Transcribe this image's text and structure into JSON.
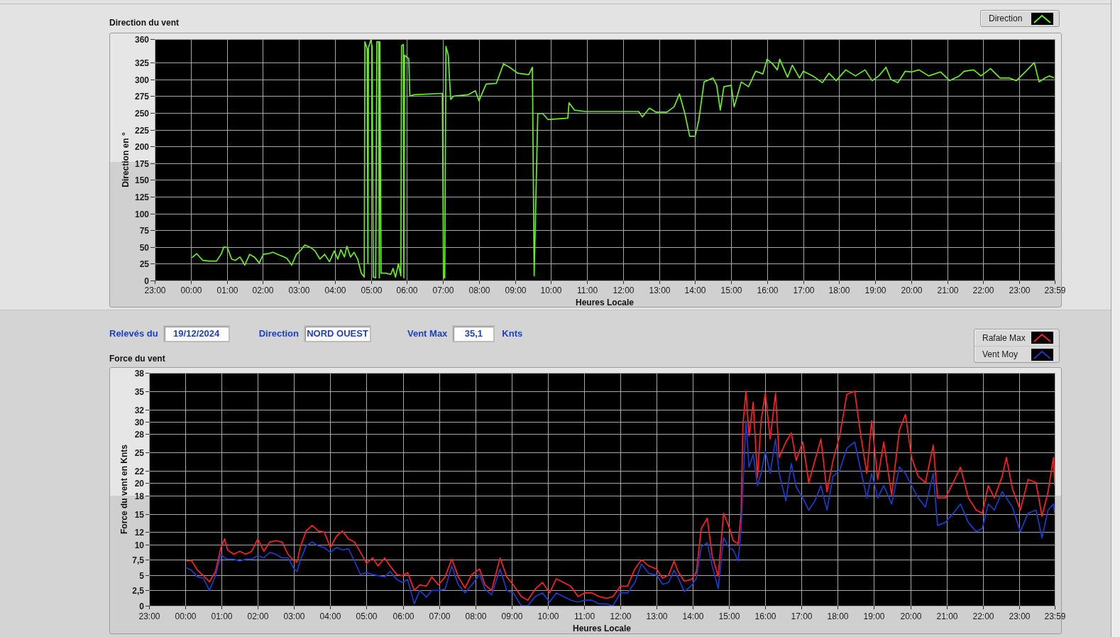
{
  "direction_graph": {
    "chart_data": {
      "type": "line",
      "title": "Direction du vent",
      "xlabel": "Heures Locale",
      "ylabel": "Direction en °",
      "grid": true,
      "x": [
        "2024-12-19 00:02",
        "2024-12-19 00:10",
        "2024-12-19 00:20",
        "2024-12-19 00:31",
        "2024-12-19 00:43",
        "2024-12-19 00:51",
        "2024-12-19 00:55",
        "2024-12-19 01:01",
        "2024-12-19 01:08",
        "2024-12-19 01:14",
        "2024-12-19 01:22",
        "2024-12-19 01:30",
        "2024-12-19 01:38",
        "2024-12-19 01:46",
        "2024-12-19 01:54",
        "2024-12-19 02:01",
        "2024-12-19 02:09",
        "2024-12-19 02:17",
        "2024-12-19 02:25",
        "2024-12-19 02:33",
        "2024-12-19 02:40",
        "2024-12-19 02:48",
        "2024-12-19 02:56",
        "2024-12-19 03:04",
        "2024-12-19 03:10",
        "2024-12-19 03:20",
        "2024-12-19 03:27",
        "2024-12-19 03:35",
        "2024-12-19 03:43",
        "2024-12-19 03:51",
        "2024-12-19 03:59",
        "2024-12-19 04:05",
        "2024-12-19 04:10",
        "2024-12-19 04:16",
        "2024-12-19 04:20",
        "2024-12-19 04:26",
        "2024-12-19 04:32",
        "2024-12-19 04:38",
        "2024-12-19 04:44",
        "2024-12-19 04:49",
        "2024-12-19 04:50",
        "2024-12-19 04:54",
        "2024-12-19 04:55",
        "2024-12-19 04:56",
        "2024-12-19 05:00",
        "2024-12-19 05:02",
        "2024-12-19 05:04",
        "2024-12-19 05:08",
        "2024-12-19 05:10",
        "2024-12-19 05:13",
        "2024-12-19 05:14",
        "2024-12-19 05:15",
        "2024-12-19 05:17",
        "2024-12-19 05:25",
        "2024-12-19 05:33",
        "2024-12-19 05:37",
        "2024-12-19 05:41",
        "2024-12-19 05:46",
        "2024-12-19 05:50",
        "2024-12-19 05:51",
        "2024-12-19 05:54",
        "2024-12-19 05:55",
        "2024-12-19 05:56",
        "2024-12-19 06:00",
        "2024-12-19 06:03",
        "2024-12-19 06:05",
        "2024-12-19 06:12",
        "2024-12-19 06:59",
        "2024-12-19 07:01",
        "2024-12-19 07:03",
        "2024-12-19 07:05",
        "2024-12-19 07:09",
        "2024-12-19 07:11",
        "2024-12-19 07:13",
        "2024-12-19 07:18",
        "2024-12-19 07:42",
        "2024-12-19 07:54",
        "2024-12-19 08:00",
        "2024-12-19 08:12",
        "2024-12-19 08:29",
        "2024-12-19 08:41",
        "2024-12-19 08:51",
        "2024-12-19 09:05",
        "2024-12-19 09:23",
        "2024-12-19 09:29",
        "2024-12-19 09:32",
        "2024-12-19 09:38",
        "2024-12-19 09:46",
        "2024-12-19 09:55",
        "2024-12-19 10:28",
        "2024-12-19 10:30",
        "2024-12-19 10:39",
        "2024-12-19 10:57",
        "2024-12-19 11:27",
        "2024-12-19 11:56",
        "2024-12-19 12:26",
        "2024-12-19 12:32",
        "2024-12-19 12:44",
        "2024-12-19 12:55",
        "2024-12-19 13:13",
        "2024-12-19 13:25",
        "2024-12-19 13:34",
        "2024-12-19 13:43",
        "2024-12-19 13:51",
        "2024-12-19 14:00",
        "2024-12-19 14:06",
        "2024-12-19 14:15",
        "2024-12-19 14:30",
        "2024-12-19 14:36",
        "2024-12-19 14:42",
        "2024-12-19 14:48",
        "2024-12-19 15:00",
        "2024-12-19 15:05",
        "2024-12-19 15:17",
        "2024-12-19 15:29",
        "2024-12-19 15:41",
        "2024-12-19 15:53",
        "2024-12-19 16:00",
        "2024-12-19 16:09",
        "2024-12-19 16:17",
        "2024-12-19 16:21",
        "2024-12-19 16:34",
        "2024-12-19 16:42",
        "2024-12-19 16:54",
        "2024-12-19 17:00",
        "2024-12-19 17:16",
        "2024-12-19 17:32",
        "2024-12-19 17:43",
        "2024-12-19 17:55",
        "2024-12-19 18:11",
        "2024-12-19 18:27",
        "2024-12-19 18:43",
        "2024-12-19 18:55",
        "2024-12-19 19:06",
        "2024-12-19 19:18",
        "2024-12-19 19:26",
        "2024-12-19 19:38",
        "2024-12-19 19:50",
        "2024-12-19 20:01",
        "2024-12-19 20:13",
        "2024-12-19 20:29",
        "2024-12-19 20:49",
        "2024-12-19 21:04",
        "2024-12-19 21:20",
        "2024-12-19 21:28",
        "2024-12-19 21:44",
        "2024-12-19 21:56",
        "2024-12-19 22:12",
        "2024-12-19 22:28",
        "2024-12-19 22:43",
        "2024-12-19 22:55",
        "2024-12-19 23:11",
        "2024-12-19 23:25",
        "2024-12-19 23:33",
        "2024-12-19 23:43",
        "2024-12-19 23:50",
        "2024-12-19 23:58"
      ],
      "series": [
        {
          "name": "Direction",
          "color": "#66f01e",
          "values": [
            34,
            40,
            30,
            29,
            29,
            40,
            50,
            49,
            32,
            30,
            35,
            23,
            39,
            35,
            26,
            39,
            40,
            42,
            39,
            36,
            33,
            23,
            39,
            46,
            53,
            49,
            44,
            32,
            39,
            28,
            44,
            32,
            46,
            35,
            51,
            35,
            42,
            32,
            11,
            5,
            356,
            345,
            26,
            347,
            359,
            349,
            5,
            4,
            356,
            356,
            4,
            356,
            11,
            11,
            9,
            18,
            5,
            25,
            7,
            350,
            352,
            4,
            336,
            333,
            331,
            275,
            277,
            279,
            4,
            4,
            349,
            336,
            301,
            270,
            275,
            277,
            283,
            268,
            293,
            294,
            323,
            318,
            309,
            307,
            318,
            7,
            249,
            249,
            240,
            242,
            265,
            254,
            252,
            252,
            252,
            252,
            244,
            257,
            251,
            251,
            259,
            278,
            249,
            215,
            215,
            238,
            296,
            302,
            291,
            254,
            289,
            291,
            259,
            296,
            289,
            312,
            308,
            330,
            323,
            314,
            330,
            303,
            321,
            302,
            312,
            305,
            295,
            309,
            298,
            314,
            305,
            314,
            298,
            305,
            318,
            300,
            295,
            312,
            311,
            314,
            305,
            311,
            298,
            305,
            312,
            314,
            305,
            316,
            302,
            302,
            298,
            312,
            325,
            296,
            302,
            305,
            302
          ]
        }
      ],
      "xlim": [
        "2024-12-18 23:00",
        "2024-12-19 23:59"
      ],
      "ylim": [
        0,
        360
      ],
      "xticks": [
        {
          "value": "2024-12-18 23:00",
          "label": "23:00"
        },
        {
          "value": "2024-12-19 00:00",
          "label": "00:00"
        },
        {
          "value": "2024-12-19 01:00",
          "label": "01:00"
        },
        {
          "value": "2024-12-19 02:00",
          "label": "02:00"
        },
        {
          "value": "2024-12-19 03:00",
          "label": "03:00"
        },
        {
          "value": "2024-12-19 04:00",
          "label": "04:00"
        },
        {
          "value": "2024-12-19 05:00",
          "label": "05:00"
        },
        {
          "value": "2024-12-19 06:00",
          "label": "06:00"
        },
        {
          "value": "2024-12-19 07:00",
          "label": "07:00"
        },
        {
          "value": "2024-12-19 08:00",
          "label": "08:00"
        },
        {
          "value": "2024-12-19 09:00",
          "label": "09:00"
        },
        {
          "value": "2024-12-19 10:00",
          "label": "10:00"
        },
        {
          "value": "2024-12-19 11:00",
          "label": "11:00"
        },
        {
          "value": "2024-12-19 12:00",
          "label": "12:00"
        },
        {
          "value": "2024-12-19 13:00",
          "label": "13:00"
        },
        {
          "value": "2024-12-19 14:00",
          "label": "14:00"
        },
        {
          "value": "2024-12-19 15:00",
          "label": "15:00"
        },
        {
          "value": "2024-12-19 16:00",
          "label": "16:00"
        },
        {
          "value": "2024-12-19 17:00",
          "label": "17:00"
        },
        {
          "value": "2024-12-19 18:00",
          "label": "18:00"
        },
        {
          "value": "2024-12-19 19:00",
          "label": "19:00"
        },
        {
          "value": "2024-12-19 20:00",
          "label": "20:00"
        },
        {
          "value": "2024-12-19 21:00",
          "label": "21:00"
        },
        {
          "value": "2024-12-19 22:00",
          "label": "22:00"
        },
        {
          "value": "2024-12-19 23:00",
          "label": "23:00"
        },
        {
          "value": "2024-12-19 23:59",
          "label": "23:59"
        }
      ],
      "yticks": [
        0,
        25,
        50,
        75,
        100,
        125,
        150,
        175,
        200,
        225,
        250,
        275,
        300,
        325,
        360
      ]
    }
  },
  "readings": [
    {
      "label": "Relevés du",
      "value": "19/12/2024"
    },
    {
      "label": "Direction",
      "value": "NORD OUEST"
    },
    {
      "label": "Vent Max",
      "value": "35,1",
      "unit": "Knts"
    }
  ],
  "force_graph": {
    "chart_data": {
      "type": "line",
      "title": "Force du vent",
      "xlabel": "Heures Locale",
      "ylabel": "Force du vent en Knts",
      "grid": true,
      "x": [
        "2024-12-19 00:02",
        "2024-12-19 00:10",
        "2024-12-19 00:20",
        "2024-12-19 00:30",
        "2024-12-19 00:40",
        "2024-12-19 00:50",
        "2024-12-19 00:59",
        "2024-12-19 01:05",
        "2024-12-19 01:10",
        "2024-12-19 01:20",
        "2024-12-19 01:30",
        "2024-12-19 01:40",
        "2024-12-19 01:50",
        "2024-12-19 02:00",
        "2024-12-19 02:10",
        "2024-12-19 02:20",
        "2024-12-19 02:30",
        "2024-12-19 02:40",
        "2024-12-19 02:50",
        "2024-12-19 03:00",
        "2024-12-19 03:05",
        "2024-12-19 03:10",
        "2024-12-19 03:20",
        "2024-12-19 03:30",
        "2024-12-19 03:40",
        "2024-12-19 03:50",
        "2024-12-19 04:00",
        "2024-12-19 04:10",
        "2024-12-19 04:20",
        "2024-12-19 04:30",
        "2024-12-19 04:40",
        "2024-12-19 04:50",
        "2024-12-19 05:00",
        "2024-12-19 05:10",
        "2024-12-19 05:19",
        "2024-12-19 05:30",
        "2024-12-19 05:39",
        "2024-12-19 05:50",
        "2024-12-19 05:59",
        "2024-12-19 06:08",
        "2024-12-19 06:19",
        "2024-12-19 06:28",
        "2024-12-19 06:39",
        "2024-12-19 06:48",
        "2024-12-19 06:59",
        "2024-12-19 07:10",
        "2024-12-19 07:21",
        "2024-12-19 07:32",
        "2024-12-19 07:43",
        "2024-12-19 07:54",
        "2024-12-19 08:07",
        "2024-12-19 08:16",
        "2024-12-19 08:27",
        "2024-12-19 08:41",
        "2024-12-19 08:52",
        "2024-12-19 09:03",
        "2024-12-19 09:16",
        "2024-12-19 09:27",
        "2024-12-19 09:39",
        "2024-12-19 09:51",
        "2024-12-19 10:03",
        "2024-12-19 10:14",
        "2024-12-19 10:26",
        "2024-12-19 10:38",
        "2024-12-19 10:50",
        "2024-12-19 11:01",
        "2024-12-19 11:13",
        "2024-12-19 11:25",
        "2024-12-19 11:37",
        "2024-12-19 11:48",
        "2024-12-19 12:00",
        "2024-12-19 12:12",
        "2024-12-19 12:24",
        "2024-12-19 12:35",
        "2024-12-19 12:47",
        "2024-12-19 13:00",
        "2024-12-19 13:10",
        "2024-12-19 13:20",
        "2024-12-19 13:29",
        "2024-12-19 13:36",
        "2024-12-19 13:46",
        "2024-12-19 13:58",
        "2024-12-19 14:06",
        "2024-12-19 14:14",
        "2024-12-19 14:24",
        "2024-12-19 14:32",
        "2024-12-19 14:42",
        "2024-12-19 14:51",
        "2024-12-19 14:59",
        "2024-12-19 15:07",
        "2024-12-19 15:15",
        "2024-12-19 15:20",
        "2024-12-19 15:23",
        "2024-12-19 15:28",
        "2024-12-19 15:33",
        "2024-12-19 15:40",
        "2024-12-19 15:47",
        "2024-12-19 15:53",
        "2024-12-19 16:00",
        "2024-12-19 16:08",
        "2024-12-19 16:17",
        "2024-12-19 16:23",
        "2024-12-19 16:34",
        "2024-12-19 16:43",
        "2024-12-19 16:51",
        "2024-12-19 17:02",
        "2024-12-19 17:12",
        "2024-12-19 17:22",
        "2024-12-19 17:32",
        "2024-12-19 17:42",
        "2024-12-19 17:52",
        "2024-12-19 18:03",
        "2024-12-19 18:15",
        "2024-12-19 18:28",
        "2024-12-19 18:38",
        "2024-12-19 18:48",
        "2024-12-19 18:56",
        "2024-12-19 19:06",
        "2024-12-19 19:16",
        "2024-12-19 19:29",
        "2024-12-19 19:42",
        "2024-12-19 19:52",
        "2024-12-19 20:02",
        "2024-12-19 20:13",
        "2024-12-19 20:25",
        "2024-12-19 20:38",
        "2024-12-19 20:45",
        "2024-12-19 20:58",
        "2024-12-19 21:11",
        "2024-12-19 21:23",
        "2024-12-19 21:36",
        "2024-12-19 21:49",
        "2024-12-19 21:59",
        "2024-12-19 22:09",
        "2024-12-19 22:19",
        "2024-12-19 22:32",
        "2024-12-19 22:39",
        "2024-12-19 22:49",
        "2024-12-19 23:02",
        "2024-12-19 23:15",
        "2024-12-19 23:28",
        "2024-12-19 23:38",
        "2024-12-19 23:48",
        "2024-12-19 23:57",
        "2024-12-19 23:59"
      ],
      "series": [
        {
          "name": "Rafale Max",
          "color": "#ff1f1f",
          "values": [
            7.3,
            7.4,
            5.8,
            4.9,
            3.9,
            5.6,
            9.5,
            10.9,
            9.1,
            8.4,
            8.9,
            8.4,
            8.9,
            10.9,
            8.9,
            10.4,
            10.6,
            10.4,
            8.4,
            7.3,
            7.1,
            9.5,
            12.2,
            13.1,
            12.2,
            12.0,
            9.5,
            11.3,
            12.2,
            10.9,
            10.4,
            8.7,
            6.9,
            7.8,
            6.5,
            7.8,
            6.5,
            5.1,
            4.9,
            5.4,
            2.5,
            3.4,
            3.2,
            4.7,
            3.4,
            4.7,
            7.6,
            4.7,
            2.9,
            5.1,
            6.0,
            3.4,
            2.5,
            7.8,
            4.7,
            3.4,
            1.5,
            0.9,
            2.7,
            3.8,
            2.1,
            4.4,
            3.8,
            3.2,
            1.5,
            2.1,
            2.1,
            1.5,
            1.2,
            1.5,
            3.2,
            3.2,
            6.0,
            7.5,
            6.5,
            6.0,
            4.5,
            5.0,
            7.3,
            5.5,
            4.0,
            4.3,
            5.5,
            12.6,
            14.3,
            8.1,
            4.8,
            15.1,
            13.1,
            10.6,
            10.1,
            15.1,
            29.7,
            35.0,
            27.7,
            33.2,
            20.9,
            30.2,
            34.7,
            27.2,
            34.7,
            24.2,
            26.7,
            28.2,
            23.7,
            26.7,
            20.1,
            23.7,
            27.2,
            18.6,
            23.7,
            27.7,
            34.5,
            35.0,
            27.7,
            21.6,
            30.2,
            20.6,
            26.7,
            18.1,
            28.7,
            31.2,
            24.2,
            21.1,
            20.1,
            26.2,
            17.6,
            17.6,
            20.1,
            22.6,
            17.6,
            15.6,
            15.1,
            19.6,
            17.6,
            21.1,
            24.2,
            19.1,
            15.6,
            20.6,
            20.1,
            14.6,
            18.6,
            24.2,
            19.6
          ]
        },
        {
          "name": "Vent Moy",
          "color": "#1a3ccc",
          "values": [
            6.2,
            5.8,
            4.7,
            4.5,
            2.5,
            4.9,
            8.4,
            7.8,
            7.6,
            7.6,
            7.3,
            7.6,
            7.6,
            8.2,
            7.8,
            8.7,
            8.4,
            7.8,
            7.8,
            6.0,
            5.6,
            7.3,
            9.8,
            10.4,
            9.8,
            9.5,
            8.7,
            9.5,
            9.1,
            9.3,
            7.3,
            5.1,
            5.4,
            5.1,
            4.9,
            4.7,
            5.6,
            4.3,
            3.8,
            4.3,
            0.3,
            2.5,
            1.4,
            2.5,
            2.5,
            2.7,
            6.5,
            3.4,
            2.1,
            3.4,
            5.1,
            2.7,
            1.8,
            6.0,
            2.5,
            2.1,
            0,
            0,
            1.5,
            2.1,
            0.6,
            2.1,
            1.5,
            0.9,
            0.6,
            0.9,
            0.9,
            0.3,
            0.3,
            0,
            2.1,
            2.1,
            3.8,
            6.8,
            5.3,
            5.0,
            3.5,
            3.8,
            5.8,
            4.5,
            2.3,
            3.3,
            4.5,
            9.6,
            10.3,
            6.5,
            2.8,
            11.1,
            9.6,
            9.1,
            7.3,
            12.6,
            19.6,
            30.2,
            22.6,
            24.7,
            19.6,
            21.6,
            25.2,
            21.6,
            27.2,
            21.6,
            17.1,
            23.2,
            19.4,
            17.6,
            15.6,
            17.1,
            19.6,
            15.6,
            21.1,
            22.1,
            25.7,
            26.7,
            22.1,
            17.6,
            21.6,
            17.6,
            19.6,
            16.6,
            22.6,
            21.6,
            19.6,
            17.6,
            16.1,
            21.6,
            13.1,
            13.6,
            15.1,
            16.6,
            13.6,
            12.1,
            12.6,
            16.6,
            15.6,
            18.6,
            17.6,
            16.1,
            12.1,
            15.1,
            15.6,
            11.1,
            15.6,
            16.6,
            15.1
          ]
        }
      ],
      "xlim": [
        "2024-12-18 23:00",
        "2024-12-19 23:59"
      ],
      "ylim": [
        0,
        38
      ],
      "xticks": [
        {
          "value": "2024-12-18 23:00",
          "label": "23:00"
        },
        {
          "value": "2024-12-19 00:00",
          "label": "00:00"
        },
        {
          "value": "2024-12-19 01:00",
          "label": "01:00"
        },
        {
          "value": "2024-12-19 02:00",
          "label": "02:00"
        },
        {
          "value": "2024-12-19 03:00",
          "label": "03:00"
        },
        {
          "value": "2024-12-19 04:00",
          "label": "04:00"
        },
        {
          "value": "2024-12-19 05:00",
          "label": "05:00"
        },
        {
          "value": "2024-12-19 06:00",
          "label": "06:00"
        },
        {
          "value": "2024-12-19 07:00",
          "label": "07:00"
        },
        {
          "value": "2024-12-19 08:00",
          "label": "08:00"
        },
        {
          "value": "2024-12-19 09:00",
          "label": "09:00"
        },
        {
          "value": "2024-12-19 10:00",
          "label": "10:00"
        },
        {
          "value": "2024-12-19 11:00",
          "label": "11:00"
        },
        {
          "value": "2024-12-19 12:00",
          "label": "12:00"
        },
        {
          "value": "2024-12-19 13:00",
          "label": "13:00"
        },
        {
          "value": "2024-12-19 14:00",
          "label": "14:00"
        },
        {
          "value": "2024-12-19 15:00",
          "label": "15:00"
        },
        {
          "value": "2024-12-19 16:00",
          "label": "16:00"
        },
        {
          "value": "2024-12-19 17:00",
          "label": "17:00"
        },
        {
          "value": "2024-12-19 18:00",
          "label": "18:00"
        },
        {
          "value": "2024-12-19 19:00",
          "label": "19:00"
        },
        {
          "value": "2024-12-19 20:00",
          "label": "20:00"
        },
        {
          "value": "2024-12-19 21:00",
          "label": "21:00"
        },
        {
          "value": "2024-12-19 22:00",
          "label": "22:00"
        },
        {
          "value": "2024-12-19 23:00",
          "label": "23:00"
        },
        {
          "value": "2024-12-19 23:59",
          "label": "23:59"
        }
      ],
      "yticks": [
        0,
        {
          "value": 2.5,
          "label": "2,5"
        },
        5,
        {
          "value": 7.5,
          "label": "7,5"
        },
        10,
        12,
        15,
        18,
        20,
        22,
        25,
        28,
        30,
        32,
        35,
        38
      ]
    }
  }
}
